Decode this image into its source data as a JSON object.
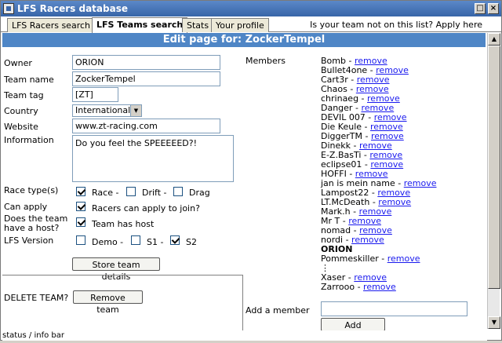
{
  "window": {
    "title": "LFS Racers database",
    "controls": [
      "□",
      "×"
    ]
  },
  "tabs": [
    {
      "label": "LFS Racers search",
      "active": false
    },
    {
      "label": "LFS Teams search",
      "active": true
    },
    {
      "label": "Stats",
      "active": false
    },
    {
      "label": "Your profile",
      "active": false
    }
  ],
  "tab_right": {
    "text": "Is your team not on this list?",
    "link": "Apply here"
  },
  "header": {
    "title": "Edit page for: ZockerTempel"
  },
  "form": {
    "owner_label": "Owner",
    "owner_value": "ORION",
    "team_name_label": "Team name",
    "team_name_value": "ZockerTempel",
    "team_tag_label": "Team tag",
    "team_tag_value": "[ZT]",
    "country_label": "Country",
    "country_value": "International",
    "website_label": "Website",
    "website_value": "www.zt-racing.com",
    "info_label": "Information",
    "info_value": "Do you feel the SPEEEEED?!",
    "race_types_label": "Race type(s)",
    "race_types": [
      {
        "label": "Race -",
        "checked": true
      },
      {
        "label": "Drift -",
        "checked": false
      },
      {
        "label": "Drag",
        "checked": false
      }
    ],
    "can_apply_label": "Can apply",
    "can_apply_text": "Racers can apply to join?",
    "can_apply_checked": true,
    "host_label": "Does the team have a host?",
    "host_text": "Team has host",
    "host_checked": true,
    "version_label": "LFS Version",
    "versions": [
      {
        "label": "Demo -",
        "checked": false
      },
      {
        "label": "S1 -",
        "checked": false
      },
      {
        "label": "S2",
        "checked": true
      }
    ],
    "store_button": "Store team details",
    "delete_label": "DELETE TEAM?",
    "remove_button": "Remove team"
  },
  "members": {
    "label": "Members",
    "remove_text": "remove",
    "list": [
      {
        "name": "Bomb",
        "removable": true
      },
      {
        "name": "Bullet4one",
        "removable": true
      },
      {
        "name": "Cart3r",
        "removable": true
      },
      {
        "name": "Chaos",
        "removable": true
      },
      {
        "name": "chrinaeg",
        "removable": true
      },
      {
        "name": "Danger",
        "removable": true
      },
      {
        "name": "DEVIL 007",
        "removable": true
      },
      {
        "name": "Die Keule",
        "removable": true
      },
      {
        "name": "DiggerTM",
        "removable": true
      },
      {
        "name": "Dinekk",
        "removable": true
      },
      {
        "name": "E-Z.BasTi",
        "removable": true
      },
      {
        "name": "eclipse01",
        "removable": true
      },
      {
        "name": "HOFFI",
        "removable": true
      },
      {
        "name": "jan is mein name",
        "removable": true
      },
      {
        "name": "Lampost22",
        "removable": true
      },
      {
        "name": "LT.McDeath",
        "removable": true
      },
      {
        "name": "Mark.h",
        "removable": true
      },
      {
        "name": "Mr T",
        "removable": true
      },
      {
        "name": "nomad",
        "removable": true
      },
      {
        "name": "nordi",
        "removable": true
      },
      {
        "name": "ORION",
        "removable": false,
        "bold": true
      },
      {
        "name": "Pommeskiller",
        "removable": true
      },
      {
        "name": "⋮",
        "removable": false,
        "dots": true
      },
      {
        "name": "Xaser",
        "removable": true
      },
      {
        "name": "Zarrooo",
        "removable": true
      }
    ],
    "add_label": "Add a member",
    "add_placeholder": "",
    "add_button": "Add member"
  },
  "status": {
    "text": "status / info bar"
  }
}
